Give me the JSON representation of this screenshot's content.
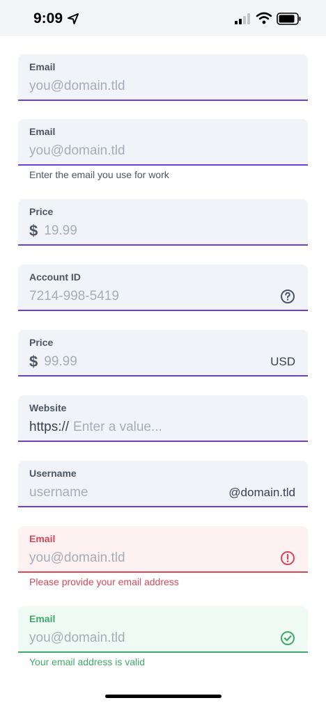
{
  "status_bar": {
    "time": "9:09",
    "icons": [
      "location-arrow-icon",
      "cellular-signal-icon",
      "wifi-icon",
      "battery-icon"
    ]
  },
  "colors": {
    "accent": "#6b3fd4",
    "error": "#d4475a",
    "success": "#3fa86a",
    "field_bg": "#f0f3f8"
  },
  "fields": [
    {
      "label": "Email",
      "placeholder": "you@domain.tld"
    },
    {
      "label": "Email",
      "placeholder": "you@domain.tld",
      "hint": "Enter the email you use for work"
    },
    {
      "label": "Price",
      "prefix_icon": "dollar-icon",
      "placeholder": "19.99"
    },
    {
      "label": "Account ID",
      "placeholder": "7214-998-5419",
      "trailing_icon": "help-circle-icon"
    },
    {
      "label": "Price",
      "prefix_icon": "dollar-icon",
      "placeholder": "99.99",
      "suffix": "USD"
    },
    {
      "label": "Website",
      "prefix": "https://",
      "placeholder": "Enter a value..."
    },
    {
      "label": "Username",
      "placeholder": "username",
      "suffix": "@domain.tld"
    },
    {
      "label": "Email",
      "placeholder": "you@domain.tld",
      "state": "error",
      "trailing_icon": "error-circle-icon",
      "hint": "Please provide your email address"
    },
    {
      "label": "Email",
      "placeholder": "you@domain.tld",
      "state": "success",
      "trailing_icon": "check-circle-icon",
      "hint": "Your email address is valid"
    }
  ]
}
